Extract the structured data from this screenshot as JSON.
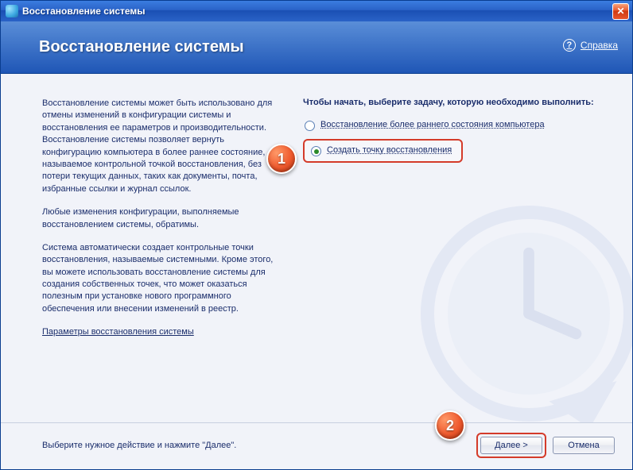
{
  "titlebar": {
    "title": "Восстановление системы"
  },
  "header": {
    "title": "Восстановление системы",
    "help_label": "Справка"
  },
  "description": {
    "p1": "Восстановление системы может быть использовано для отмены изменений в конфигурации системы и восстановления ее параметров и производительности. Восстановление системы позволяет вернуть конфигурацию компьютера в более раннее состояние, называемое контрольной точкой восстановления, без потери текущих данных, таких как документы, почта, избранные ссылки и журнал ссылок.",
    "p2": "Любые изменения конфигурации, выполняемые восстановлением системы, обратимы.",
    "p3": "Система автоматически создает контрольные точки восстановления, называемые системными. Кроме этого, вы можете использовать восстановление системы для создания собственных точек, что может оказаться полезным при установке нового программного обеспечения или внесении изменений в реестр.",
    "settings_link": "Параметры восстановления системы"
  },
  "tasks": {
    "header": "Чтобы начать, выберите задачу, которую необходимо выполнить:",
    "option1": "Восстановление более раннего состояния компьютера",
    "option2": "Создать точку восстановления"
  },
  "markers": {
    "m1": "1",
    "m2": "2"
  },
  "footer": {
    "hint": "Выберите нужное действие и нажмите \"Далее\".",
    "next": "Далее >",
    "cancel": "Отмена"
  }
}
